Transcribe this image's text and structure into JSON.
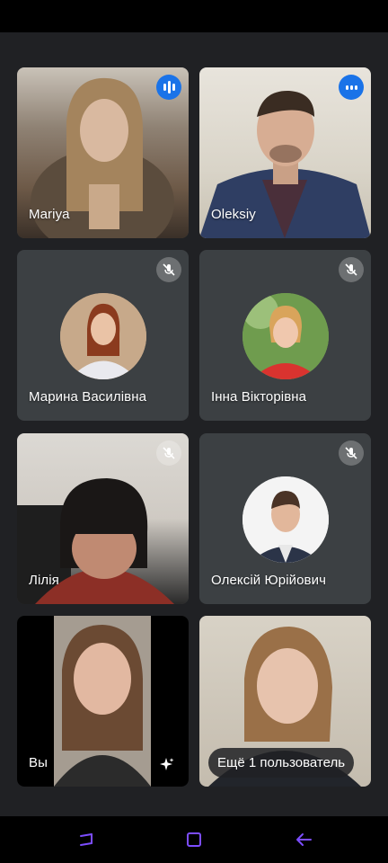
{
  "participants": [
    {
      "name": "Mariya",
      "status": "speaking"
    },
    {
      "name": "Oleksiy",
      "status": "speaking"
    },
    {
      "name": "Марина Василівна",
      "status": "muted"
    },
    {
      "name": "Інна Вікторівна",
      "status": "muted"
    },
    {
      "name": "Лілія",
      "status": "muted"
    },
    {
      "name": "Олексій Юрійович",
      "status": "muted"
    },
    {
      "name": "Вы",
      "status": "self"
    }
  ],
  "more_participants_label": "Ещё 1 пользователь",
  "icons": {
    "speaking": "audio-level-icon",
    "muted": "mic-off-icon",
    "effects": "sparkle-icon",
    "nav_recents": "recents-icon",
    "nav_home": "home-icon",
    "nav_back": "back-icon"
  },
  "colors": {
    "background": "#202124",
    "tile": "#3c4043",
    "speaking_badge": "#1a73e8",
    "nav_icons": "#7c4dff"
  }
}
